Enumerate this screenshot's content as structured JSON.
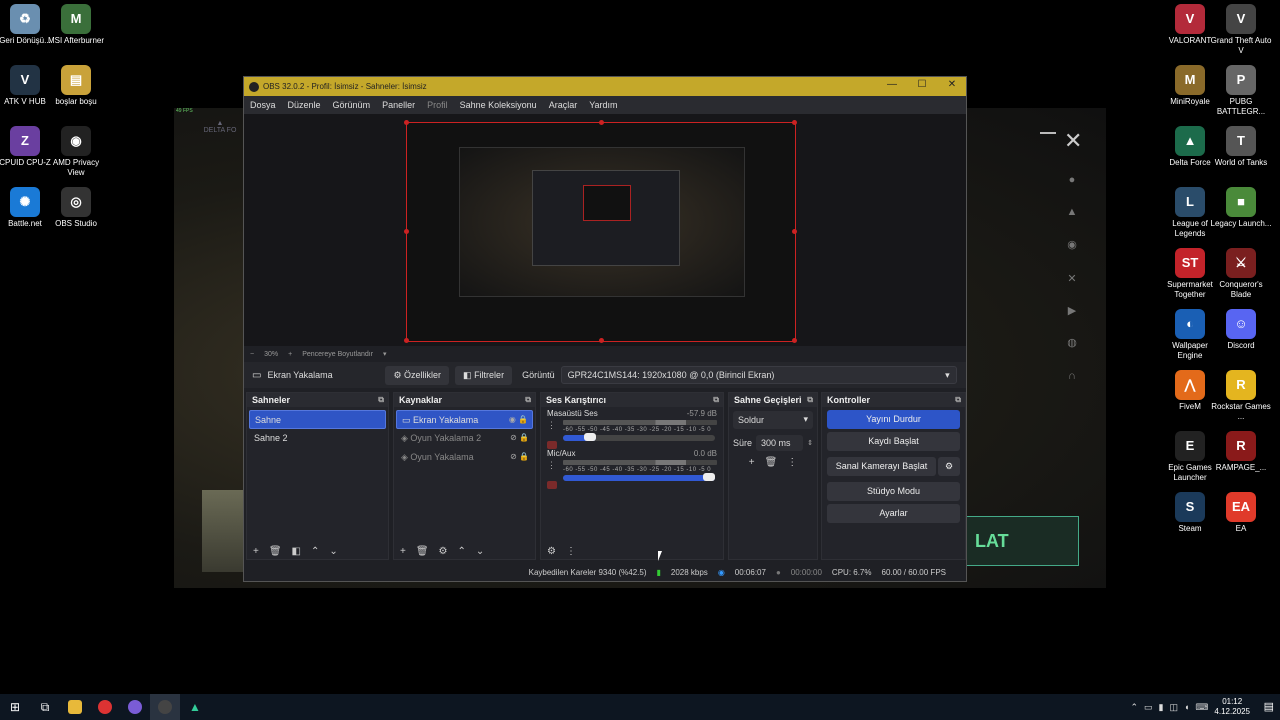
{
  "background_app": {
    "fps": "49 FPS",
    "logo": "DELTA FO",
    "banner": "LAT"
  },
  "desktop_left": [
    {
      "label": "Geri Dönüşü...",
      "icon": "recycle-bin-icon",
      "color": "#6a8fb0",
      "glyph": "♻"
    },
    {
      "label": "MSI Afterburner",
      "icon": "msi-afterburner-icon",
      "color": "#3a6f3a",
      "glyph": "M"
    },
    {
      "label": "ATK V HUB",
      "icon": "atk-hub-icon",
      "color": "#234",
      "glyph": "V"
    },
    {
      "label": "boşlar boşu",
      "icon": "folder-icon",
      "color": "#c9a23a",
      "glyph": "▤"
    },
    {
      "label": "CPUID CPU-Z",
      "icon": "cpuz-icon",
      "color": "#6a3fa0",
      "glyph": "Z"
    },
    {
      "label": "AMD Privacy View",
      "icon": "amd-privacy-icon",
      "color": "#222",
      "glyph": "◉"
    },
    {
      "label": "Battle.net",
      "icon": "battlenet-icon",
      "color": "#1a7ad6",
      "glyph": "✺"
    },
    {
      "label": "OBS Studio",
      "icon": "obs-icon",
      "color": "#333",
      "glyph": "◎"
    }
  ],
  "desktop_right": [
    {
      "label": "VALORANT",
      "icon": "valorant-icon",
      "color": "#b32a3a",
      "glyph": "V"
    },
    {
      "label": "Grand Theft Auto V",
      "icon": "gta-icon",
      "color": "#444",
      "glyph": "V"
    },
    {
      "label": "MiniRoyale",
      "icon": "miniroyale-icon",
      "color": "#8a6a2a",
      "glyph": "M"
    },
    {
      "label": "PUBG BATTLEGR...",
      "icon": "pubg-icon",
      "color": "#666",
      "glyph": "P"
    },
    {
      "label": "Delta Force",
      "icon": "delta-force-icon",
      "color": "#1c6b4b",
      "glyph": "▲"
    },
    {
      "label": "World of Tanks",
      "icon": "wot-icon",
      "color": "#555",
      "glyph": "T"
    },
    {
      "label": "League of Legends",
      "icon": "lol-icon",
      "color": "#2a4c6a",
      "glyph": "L"
    },
    {
      "label": "Legacy Launch...",
      "icon": "legacy-launcher-icon",
      "color": "#4a8a3a",
      "glyph": "■"
    },
    {
      "label": "Supermarket Together",
      "icon": "supermarket-icon",
      "color": "#c3232a",
      "glyph": "ST"
    },
    {
      "label": "Conqueror's Blade",
      "icon": "conquerors-blade-icon",
      "color": "#7a1f1f",
      "glyph": "⚔"
    },
    {
      "label": "Wallpaper Engine",
      "icon": "wallpaper-engine-icon",
      "color": "#1a5fb4",
      "glyph": "◐"
    },
    {
      "label": "Discord",
      "icon": "discord-icon",
      "color": "#5865f2",
      "glyph": "☺"
    },
    {
      "label": "FiveM",
      "icon": "fivem-icon",
      "color": "#e36a1a",
      "glyph": "⋀"
    },
    {
      "label": "Rockstar Games ...",
      "icon": "rockstar-icon",
      "color": "#e4b51f",
      "glyph": "R"
    },
    {
      "label": "Epic Games Launcher",
      "icon": "epic-games-icon",
      "color": "#222",
      "glyph": "E"
    },
    {
      "label": "RAMPAGE_...",
      "icon": "rampage-icon",
      "color": "#8a1a1a",
      "glyph": "R"
    },
    {
      "label": "Steam",
      "icon": "steam-icon",
      "color": "#1b3a5a",
      "glyph": "S"
    },
    {
      "label": "EA",
      "icon": "ea-icon",
      "color": "#e03a2a",
      "glyph": "EA"
    }
  ],
  "obs": {
    "title": "OBS 32.0.2 - Profil: İsimsiz - Sahneler: İsimsiz",
    "menu": [
      "Dosya",
      "Düzenle",
      "Görünüm",
      "Paneller",
      "Profil",
      "Sahne Koleksiyonu",
      "Araçlar",
      "Yardım"
    ],
    "zoom": {
      "minus": "−",
      "value": "30%",
      "plus": "+",
      "fit": "Pencereye Boyutlandır"
    },
    "source_bar": {
      "source_name": "Ekran Yakalama",
      "properties": "Özellikler",
      "filters": "Filtreler",
      "display_label": "Görüntü",
      "display_value": "GPR24C1MS144: 1920x1080 @ 0,0 (Birincil Ekran)"
    },
    "scenes": {
      "title": "Sahneler",
      "items": [
        "Sahne",
        "Sahne 2"
      ]
    },
    "sources": {
      "title": "Kaynaklar",
      "items": [
        "Ekran Yakalama",
        "Oyun Yakalama 2",
        "Oyun Yakalama"
      ]
    },
    "mixer": {
      "title": "Ses Karıştırıcı",
      "channels": [
        {
          "name": "Masaüstü Ses",
          "db": "-57.9 dB",
          "volume": 0.22
        },
        {
          "name": "Mic/Aux",
          "db": "0.0 dB",
          "volume": 1.0
        }
      ],
      "scale": "-60 -55 -50 -45 -40 -35 -30 -25 -20 -15 -10 -5 0"
    },
    "transitions": {
      "title": "Sahne Geçişleri",
      "type": "Soldur",
      "duration_label": "Süre",
      "duration": "300 ms"
    },
    "controls": {
      "title": "Kontroller",
      "buttons": [
        "Yayını Durdur",
        "Kaydı Başlat",
        "Sanal Kamerayı Başlat",
        "Stüdyo Modu",
        "Ayarlar"
      ]
    },
    "status": {
      "dropped": "Kaybedilen Kareler 9340 (%42.5)",
      "bitrate": "2028 kbps",
      "stream_time": "00:06:07",
      "record_time": "00:00:00",
      "cpu": "CPU: 6.7%",
      "fps": "60.00 / 60.00 FPS"
    }
  },
  "taskbar": {
    "time": "01:12",
    "date": "4.12.2025"
  }
}
